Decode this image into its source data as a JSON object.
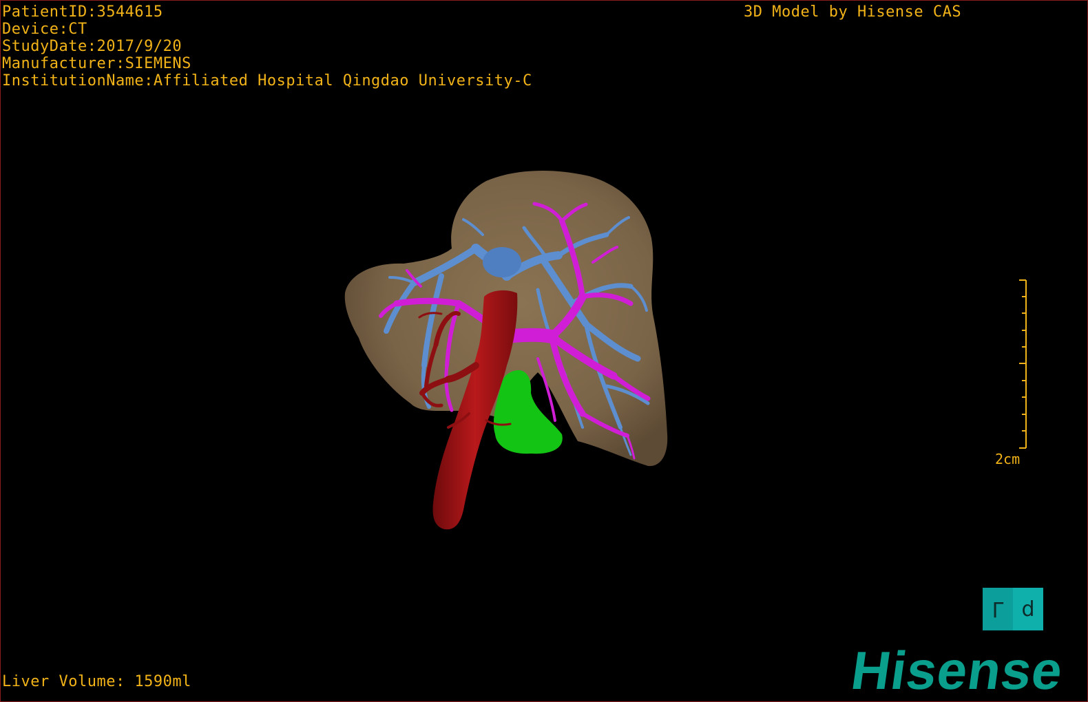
{
  "overlay": {
    "patient_line": "PatientID:3544615",
    "device_line": "Device:CT",
    "study_date_line": "StudyDate:2017/9/20",
    "manufacturer_line": "Manufacturer:SIEMENS",
    "institution_line": "InstitutionName:Affiliated Hospital Qingdao University-C",
    "model_credit": "3D Model by Hisense CAS",
    "liver_volume": "Liver Volume: 1590ml"
  },
  "scale": {
    "label": "2cm"
  },
  "orientation": {
    "left_face": "L",
    "right_face": "d"
  },
  "brand": {
    "logo_text": "Hisense"
  },
  "colors": {
    "overlay_text": "#f2b318",
    "liver": "#7a6448",
    "portal_vein": "#d01ed6",
    "hepatic_vein": "#5c8ed0",
    "aorta": "#a01416",
    "gallbladder": "#14c414",
    "brand": "#0a9f8c",
    "orientation_cube": "#0b9e9a",
    "frame_border": "#8a1c1c"
  }
}
